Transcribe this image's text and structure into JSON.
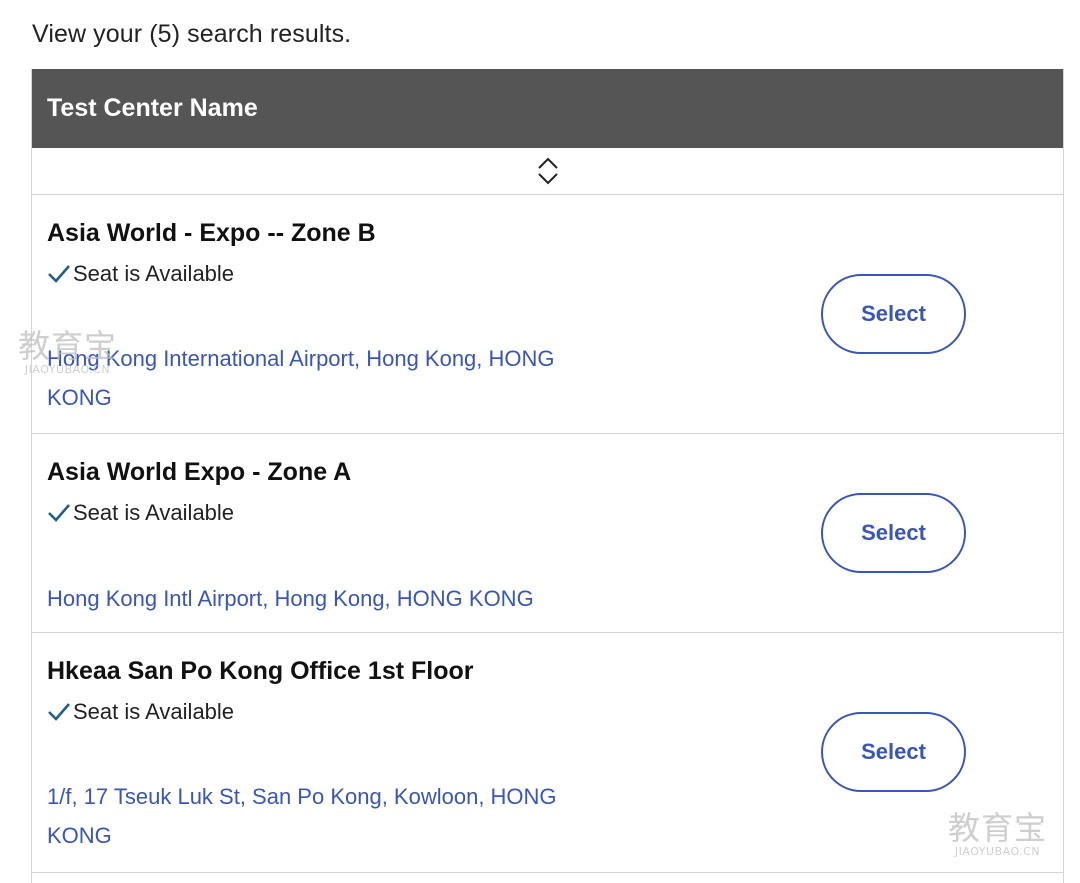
{
  "summary_text": "View your (5) search results.",
  "table": {
    "column_header": "Test Center Name",
    "sort_icon": "sort-updown-icon",
    "rows": [
      {
        "name": "Asia World - Expo -- Zone B",
        "availability": "Seat is Available",
        "address": "Hong Kong International Airport, Hong Kong, HONG KONG",
        "button_label": "Select"
      },
      {
        "name": "Asia World Expo - Zone A",
        "availability": "Seat is Available",
        "address": "Hong Kong Intl Airport, Hong Kong, HONG KONG",
        "button_label": "Select"
      },
      {
        "name": "Hkeaa San Po Kong Office 1st Floor",
        "availability": "Seat is Available",
        "address": "1/f, 17 Tseuk Luk St, San Po Kong, Kowloon, HONG KONG",
        "button_label": "Select"
      }
    ]
  },
  "watermarks": {
    "chinese": "教育宝",
    "domain": "JIAOYUBAO.CN"
  },
  "colors": {
    "header_bg": "#555555",
    "link": "#3a55b8",
    "check": "#1f5f8b",
    "divider": "#d4d4d4"
  }
}
